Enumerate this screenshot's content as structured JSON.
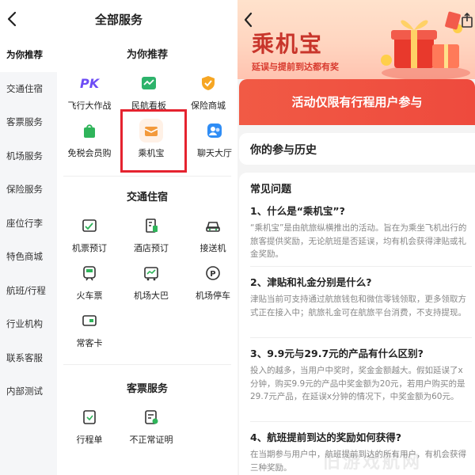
{
  "left": {
    "title": "全部服务",
    "categories": [
      "为你推荐",
      "交通住宿",
      "客票服务",
      "机场服务",
      "保险服务",
      "座位行李",
      "特色商城",
      "航班/行程",
      "行业机构",
      "联系客服",
      "内部测试"
    ],
    "sections": [
      {
        "title": "为你推荐",
        "items": [
          {
            "label": "飞行大作战",
            "icon": "pk-icon"
          },
          {
            "label": "民航看板",
            "icon": "chart-icon"
          },
          {
            "label": "保险商城",
            "icon": "shield-icon"
          },
          {
            "label": "免税会员购",
            "icon": "shopping-bag-icon"
          },
          {
            "label": "乘机宝",
            "icon": "gift-box-icon"
          },
          {
            "label": "聊天大厅",
            "icon": "chat-people-icon"
          }
        ]
      },
      {
        "title": "交通住宿",
        "items": [
          {
            "label": "机票预订",
            "icon": "ticket-icon"
          },
          {
            "label": "酒店预订",
            "icon": "hotel-icon"
          },
          {
            "label": "接送机",
            "icon": "car-icon"
          },
          {
            "label": "火车票",
            "icon": "train-icon"
          },
          {
            "label": "机场大巴",
            "icon": "bus-icon"
          },
          {
            "label": "机场停车",
            "icon": "parking-icon"
          },
          {
            "label": "常客卡",
            "icon": "card-icon"
          }
        ]
      },
      {
        "title": "客票服务",
        "items": [
          {
            "label": "行程单",
            "icon": "itinerary-icon"
          },
          {
            "label": "不正常证明",
            "icon": "certificate-icon"
          }
        ]
      }
    ]
  },
  "right": {
    "brand": "乘机宝",
    "tagline": "延误与提前到达都有奖",
    "banner": "活动仅限有行程用户参与",
    "history": "你的参与历史",
    "faq_title": "常见问题",
    "faq": [
      {
        "q": "1、什么是“乘机宝”?",
        "a": "“乘机宝”是由航旅纵横推出的活动。旨在为乘坐飞机出行的旅客提供奖励，无论航班是否延误，均有机会获得津贴或礼金奖励。"
      },
      {
        "q": "2、津贴和礼金分别是什么?",
        "a": "津贴当前可支持通过航旅钱包和微信零钱领取，更多领取方式正在接入中；航旅礼金可在航旅平台消费，不支持提现。"
      },
      {
        "q": "3、9.9元与29.7元的产品有什么区别?",
        "a": "投入的越多，当用户中奖时，奖金金额越大。假如延误了x分钟，购买9.9元的产品中奖金额为20元，若用户购买的是29.7元产品，在延误x分钟的情况下，中奖金额为60元。"
      },
      {
        "q": "4、航班提前到达的奖励如何获得?",
        "a": "在当期参与用户中，航班提前到达的所有用户，有机会获得三种奖励。"
      }
    ]
  },
  "watermark": "旧游戏航网",
  "colors": {
    "accent": "#e5232f",
    "banner": "#ef4f40",
    "brand": "#c8352b"
  }
}
